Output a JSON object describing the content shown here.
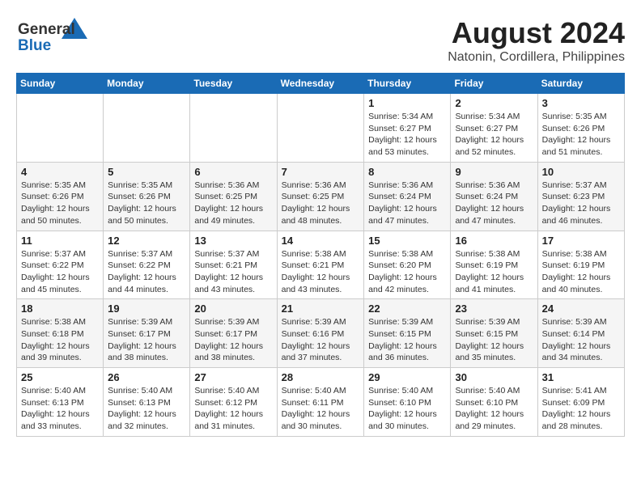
{
  "header": {
    "logo_general": "General",
    "logo_blue": "Blue",
    "title": "August 2024",
    "subtitle": "Natonin, Cordillera, Philippines"
  },
  "calendar": {
    "days_of_week": [
      "Sunday",
      "Monday",
      "Tuesday",
      "Wednesday",
      "Thursday",
      "Friday",
      "Saturday"
    ],
    "weeks": [
      [
        {
          "day": "",
          "info": ""
        },
        {
          "day": "",
          "info": ""
        },
        {
          "day": "",
          "info": ""
        },
        {
          "day": "",
          "info": ""
        },
        {
          "day": "1",
          "info": "Sunrise: 5:34 AM\nSunset: 6:27 PM\nDaylight: 12 hours\nand 53 minutes."
        },
        {
          "day": "2",
          "info": "Sunrise: 5:34 AM\nSunset: 6:27 PM\nDaylight: 12 hours\nand 52 minutes."
        },
        {
          "day": "3",
          "info": "Sunrise: 5:35 AM\nSunset: 6:26 PM\nDaylight: 12 hours\nand 51 minutes."
        }
      ],
      [
        {
          "day": "4",
          "info": "Sunrise: 5:35 AM\nSunset: 6:26 PM\nDaylight: 12 hours\nand 50 minutes."
        },
        {
          "day": "5",
          "info": "Sunrise: 5:35 AM\nSunset: 6:26 PM\nDaylight: 12 hours\nand 50 minutes."
        },
        {
          "day": "6",
          "info": "Sunrise: 5:36 AM\nSunset: 6:25 PM\nDaylight: 12 hours\nand 49 minutes."
        },
        {
          "day": "7",
          "info": "Sunrise: 5:36 AM\nSunset: 6:25 PM\nDaylight: 12 hours\nand 48 minutes."
        },
        {
          "day": "8",
          "info": "Sunrise: 5:36 AM\nSunset: 6:24 PM\nDaylight: 12 hours\nand 47 minutes."
        },
        {
          "day": "9",
          "info": "Sunrise: 5:36 AM\nSunset: 6:24 PM\nDaylight: 12 hours\nand 47 minutes."
        },
        {
          "day": "10",
          "info": "Sunrise: 5:37 AM\nSunset: 6:23 PM\nDaylight: 12 hours\nand 46 minutes."
        }
      ],
      [
        {
          "day": "11",
          "info": "Sunrise: 5:37 AM\nSunset: 6:22 PM\nDaylight: 12 hours\nand 45 minutes."
        },
        {
          "day": "12",
          "info": "Sunrise: 5:37 AM\nSunset: 6:22 PM\nDaylight: 12 hours\nand 44 minutes."
        },
        {
          "day": "13",
          "info": "Sunrise: 5:37 AM\nSunset: 6:21 PM\nDaylight: 12 hours\nand 43 minutes."
        },
        {
          "day": "14",
          "info": "Sunrise: 5:38 AM\nSunset: 6:21 PM\nDaylight: 12 hours\nand 43 minutes."
        },
        {
          "day": "15",
          "info": "Sunrise: 5:38 AM\nSunset: 6:20 PM\nDaylight: 12 hours\nand 42 minutes."
        },
        {
          "day": "16",
          "info": "Sunrise: 5:38 AM\nSunset: 6:19 PM\nDaylight: 12 hours\nand 41 minutes."
        },
        {
          "day": "17",
          "info": "Sunrise: 5:38 AM\nSunset: 6:19 PM\nDaylight: 12 hours\nand 40 minutes."
        }
      ],
      [
        {
          "day": "18",
          "info": "Sunrise: 5:38 AM\nSunset: 6:18 PM\nDaylight: 12 hours\nand 39 minutes."
        },
        {
          "day": "19",
          "info": "Sunrise: 5:39 AM\nSunset: 6:17 PM\nDaylight: 12 hours\nand 38 minutes."
        },
        {
          "day": "20",
          "info": "Sunrise: 5:39 AM\nSunset: 6:17 PM\nDaylight: 12 hours\nand 38 minutes."
        },
        {
          "day": "21",
          "info": "Sunrise: 5:39 AM\nSunset: 6:16 PM\nDaylight: 12 hours\nand 37 minutes."
        },
        {
          "day": "22",
          "info": "Sunrise: 5:39 AM\nSunset: 6:15 PM\nDaylight: 12 hours\nand 36 minutes."
        },
        {
          "day": "23",
          "info": "Sunrise: 5:39 AM\nSunset: 6:15 PM\nDaylight: 12 hours\nand 35 minutes."
        },
        {
          "day": "24",
          "info": "Sunrise: 5:39 AM\nSunset: 6:14 PM\nDaylight: 12 hours\nand 34 minutes."
        }
      ],
      [
        {
          "day": "25",
          "info": "Sunrise: 5:40 AM\nSunset: 6:13 PM\nDaylight: 12 hours\nand 33 minutes."
        },
        {
          "day": "26",
          "info": "Sunrise: 5:40 AM\nSunset: 6:13 PM\nDaylight: 12 hours\nand 32 minutes."
        },
        {
          "day": "27",
          "info": "Sunrise: 5:40 AM\nSunset: 6:12 PM\nDaylight: 12 hours\nand 31 minutes."
        },
        {
          "day": "28",
          "info": "Sunrise: 5:40 AM\nSunset: 6:11 PM\nDaylight: 12 hours\nand 30 minutes."
        },
        {
          "day": "29",
          "info": "Sunrise: 5:40 AM\nSunset: 6:10 PM\nDaylight: 12 hours\nand 30 minutes."
        },
        {
          "day": "30",
          "info": "Sunrise: 5:40 AM\nSunset: 6:10 PM\nDaylight: 12 hours\nand 29 minutes."
        },
        {
          "day": "31",
          "info": "Sunrise: 5:41 AM\nSunset: 6:09 PM\nDaylight: 12 hours\nand 28 minutes."
        }
      ]
    ]
  }
}
